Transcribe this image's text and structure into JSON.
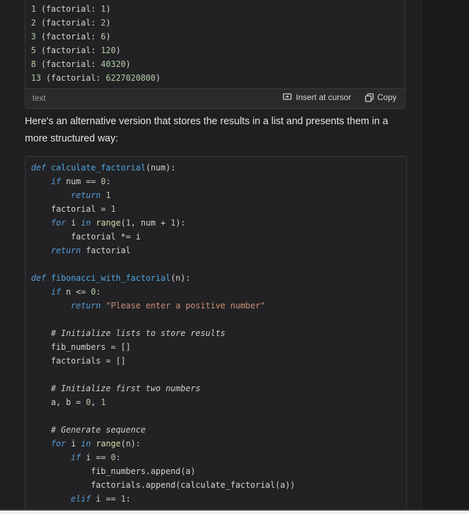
{
  "output_block": {
    "lines": [
      {
        "n": "1",
        "mid": " (factorial: ",
        "v": "1",
        "end": ")"
      },
      {
        "n": "2",
        "mid": " (factorial: ",
        "v": "2",
        "end": ")"
      },
      {
        "n": "3",
        "mid": " (factorial: ",
        "v": "6",
        "end": ")"
      },
      {
        "n": "5",
        "mid": " (factorial: ",
        "v": "120",
        "end": ")"
      },
      {
        "n": "8",
        "mid": " (factorial: ",
        "v": "40320",
        "end": ")"
      },
      {
        "n": "13",
        "mid": " (factorial: ",
        "v": "6227020800",
        "end": ")"
      }
    ],
    "language": "text",
    "insert_label": "Insert at cursor",
    "copy_label": "Copy"
  },
  "message": {
    "text": "Here's an alternative version that stores the results in a list and presents them in a more structured way:"
  },
  "code_block": {
    "lines": [
      [
        {
          "t": "def",
          "c": "kw"
        },
        {
          "t": " "
        },
        {
          "t": "calculate_factorial",
          "c": "fn"
        },
        {
          "t": "(num):"
        }
      ],
      [
        {
          "t": "    "
        },
        {
          "t": "if",
          "c": "kw"
        },
        {
          "t": " num == "
        },
        {
          "t": "0",
          "c": "nm"
        },
        {
          "t": ":"
        }
      ],
      [
        {
          "t": "        "
        },
        {
          "t": "return",
          "c": "kw"
        },
        {
          "t": " "
        },
        {
          "t": "1",
          "c": "nm"
        }
      ],
      [
        {
          "t": "    factorial = "
        },
        {
          "t": "1",
          "c": "nm"
        }
      ],
      [
        {
          "t": "    "
        },
        {
          "t": "for",
          "c": "kw"
        },
        {
          "t": " i "
        },
        {
          "t": "in",
          "c": "kw"
        },
        {
          "t": " "
        },
        {
          "t": "range",
          "c": "bi"
        },
        {
          "t": "("
        },
        {
          "t": "1",
          "c": "nm"
        },
        {
          "t": ", num + "
        },
        {
          "t": "1",
          "c": "nm"
        },
        {
          "t": "):"
        }
      ],
      [
        {
          "t": "        factorial *= i"
        }
      ],
      [
        {
          "t": "    "
        },
        {
          "t": "return",
          "c": "kw"
        },
        {
          "t": " factorial"
        }
      ],
      [],
      [
        {
          "t": "def",
          "c": "kw"
        },
        {
          "t": " "
        },
        {
          "t": "fibonacci_with_factorial",
          "c": "fn"
        },
        {
          "t": "(n):"
        }
      ],
      [
        {
          "t": "    "
        },
        {
          "t": "if",
          "c": "kw"
        },
        {
          "t": " n <= "
        },
        {
          "t": "0",
          "c": "nm"
        },
        {
          "t": ":"
        }
      ],
      [
        {
          "t": "        "
        },
        {
          "t": "return",
          "c": "kw"
        },
        {
          "t": " "
        },
        {
          "t": "\"Please enter a positive number\"",
          "c": "str"
        }
      ],
      [],
      [
        {
          "t": "    "
        },
        {
          "t": "# Initialize lists to store results",
          "c": "cm"
        }
      ],
      [
        {
          "t": "    fib_numbers = []"
        }
      ],
      [
        {
          "t": "    factorials = []"
        }
      ],
      [],
      [
        {
          "t": "    "
        },
        {
          "t": "# Initialize first two numbers",
          "c": "cm"
        }
      ],
      [
        {
          "t": "    a, b = "
        },
        {
          "t": "0",
          "c": "nm"
        },
        {
          "t": ", "
        },
        {
          "t": "1",
          "c": "nm"
        }
      ],
      [],
      [
        {
          "t": "    "
        },
        {
          "t": "# Generate sequence",
          "c": "cm"
        }
      ],
      [
        {
          "t": "    "
        },
        {
          "t": "for",
          "c": "kw"
        },
        {
          "t": " i "
        },
        {
          "t": "in",
          "c": "kw"
        },
        {
          "t": " "
        },
        {
          "t": "range",
          "c": "bi"
        },
        {
          "t": "(n):"
        }
      ],
      [
        {
          "t": "        "
        },
        {
          "t": "if",
          "c": "kw"
        },
        {
          "t": " i == "
        },
        {
          "t": "0",
          "c": "nm"
        },
        {
          "t": ":"
        }
      ],
      [
        {
          "t": "            fib_numbers.append(a)"
        }
      ],
      [
        {
          "t": "            factorials.append(calculate_factorial(a))"
        }
      ],
      [
        {
          "t": "        "
        },
        {
          "t": "elif",
          "c": "kw"
        },
        {
          "t": " i == "
        },
        {
          "t": "1",
          "c": "nm"
        },
        {
          "t": ":"
        }
      ]
    ]
  },
  "icons": {
    "insert": "insert-at-cursor-icon",
    "copy": "copy-icon"
  },
  "colors": {
    "background": "#1f1f21",
    "code_background": "#222224",
    "keyword": "#569cd6",
    "function": "#4fa8e0",
    "number": "#b5cea8",
    "string": "#ce9178"
  }
}
